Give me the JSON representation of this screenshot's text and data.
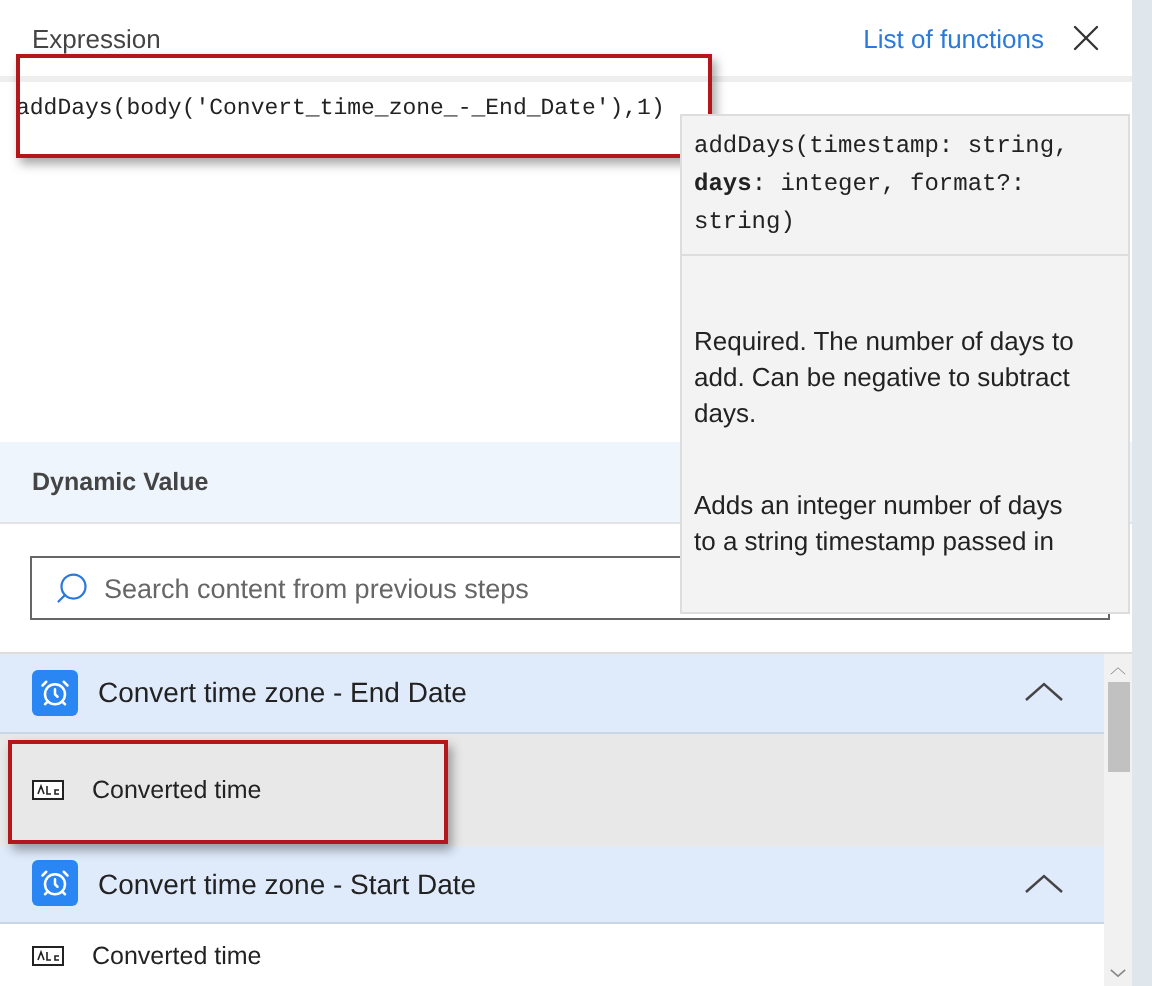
{
  "header": {
    "title": "Expression",
    "link": "List of functions"
  },
  "expression": {
    "value": "addDays(body('Convert_time_zone_-_End_Date'),1)",
    "highlighted": true
  },
  "tooltip": {
    "signature": "addDays(timestamp: string, **days**: integer, format?: string)",
    "param_description": "Required. The number of days to add. Can be negative to subtract days.",
    "function_description": "Adds an integer number of days to a string timestamp passed in"
  },
  "dynamic_value": {
    "title": "Dynamic Value",
    "search": {
      "placeholder": "Search content from previous steps"
    }
  },
  "sections": [
    {
      "title": "Convert time zone - End Date",
      "expanded": true,
      "items": [
        {
          "label": "Converted time",
          "selected": true
        }
      ]
    },
    {
      "title": "Convert time zone - Start Date",
      "expanded": true,
      "items": [
        {
          "label": "Converted time",
          "selected": false
        }
      ]
    }
  ]
}
